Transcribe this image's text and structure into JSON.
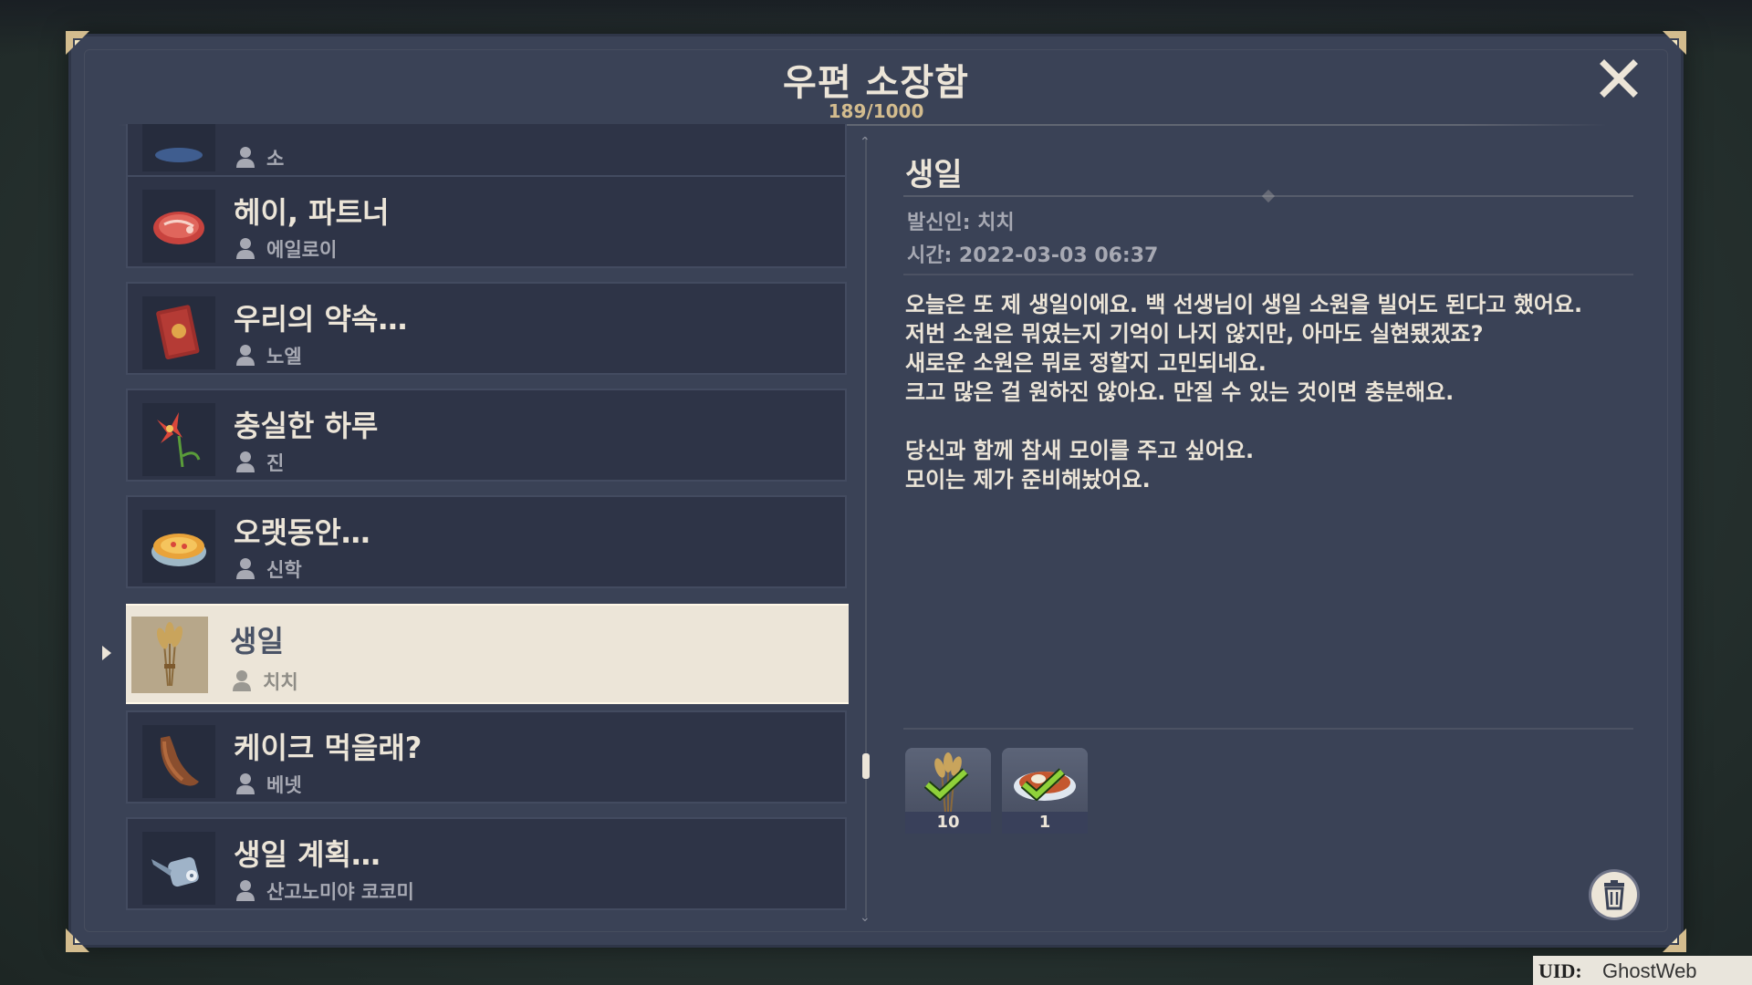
{
  "window": {
    "title": "우편 소장함",
    "count": "189/1000"
  },
  "mail_list": [
    {
      "title": "",
      "sender": "소",
      "icon": "fish-icon"
    },
    {
      "title": "헤이, 파트너",
      "sender": "에일로이",
      "icon": "raw-meat-icon"
    },
    {
      "title": "우리의 약속…",
      "sender": "노엘",
      "icon": "red-book-icon"
    },
    {
      "title": "충실한 하루",
      "sender": "진",
      "icon": "windwheel-aster-icon"
    },
    {
      "title": "오랫동안…",
      "sender": "신학",
      "icon": "soup-bowl-icon"
    },
    {
      "title": "생일",
      "sender": "치치",
      "icon": "wheat-bundle-icon",
      "selected": true
    },
    {
      "title": "케이크 먹을래?",
      "sender": "베넷",
      "icon": "horn-icon"
    },
    {
      "title": "생일 계획…",
      "sender": "산고노미야 코코미",
      "icon": "watering-can-icon"
    }
  ],
  "detail": {
    "title": "생일",
    "sender": "발신인: 치치",
    "time": "시간: 2022-03-03 06:37",
    "body": [
      "오늘은 또 제 생일이에요. 백 선생님이 생일 소원을 빌어도 된다고 했어요.",
      "저번 소원은 뭐였는지 기억이 나지 않지만, 아마도 실현됐겠죠?",
      "새로운 소원은 뭐로 정할지 고민되네요.",
      "크고 많은 걸 원하진 않아요. 만질 수 있는 것이면 충분해요.",
      "",
      "당신과 함께 참새 모이를 주고 싶어요.",
      "모이는 제가 준비해놨어요."
    ],
    "attachments": [
      {
        "qty": "10",
        "icon": "wheat-bundle-icon",
        "claimed": true
      },
      {
        "qty": "1",
        "icon": "food-dish-icon",
        "claimed": true
      }
    ]
  },
  "footer": {
    "uid_label": "UID:",
    "uid_value": "GhostWeb"
  },
  "colors": {
    "panel": "#3a4256",
    "item_bg": "#2e3447",
    "selected_bg": "#ece5d8",
    "text": "#ece5d8",
    "gold": "#d3bc8e",
    "check": "#8fd13a"
  }
}
